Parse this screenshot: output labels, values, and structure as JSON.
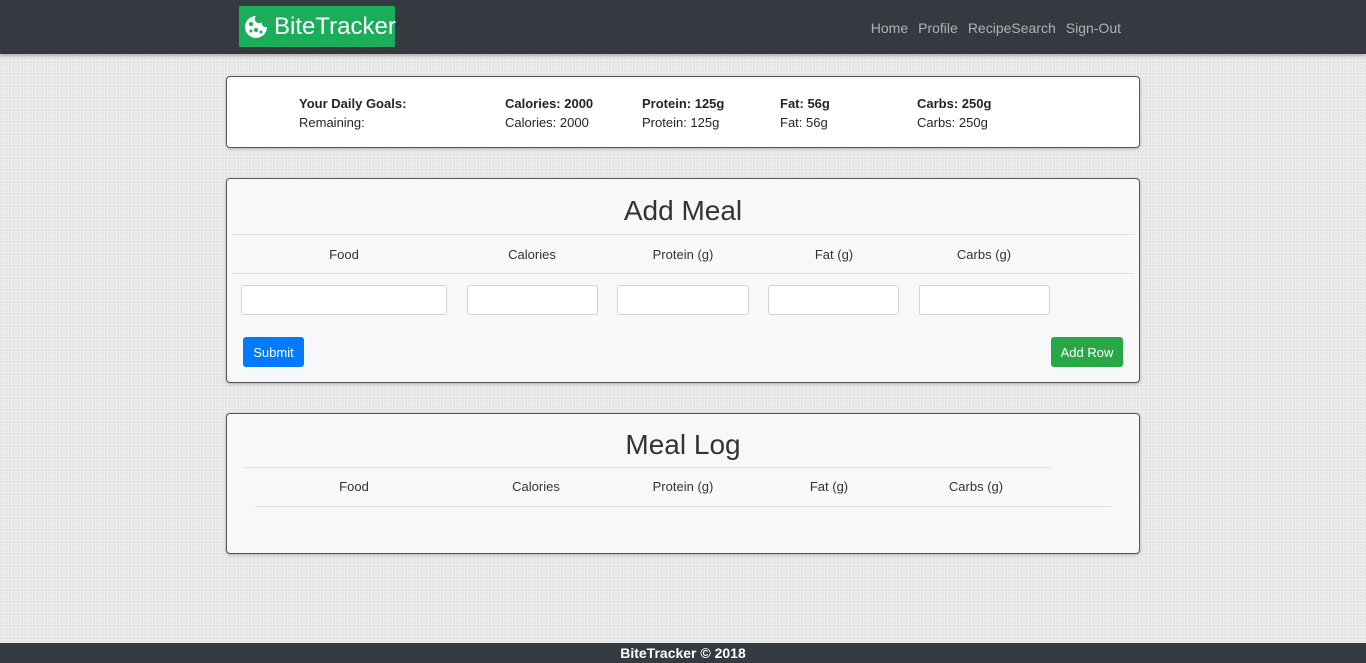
{
  "navbar": {
    "brand": "BiteTracker",
    "brand_icon": "cookie-icon",
    "links": [
      "Home",
      "Profile",
      "RecipeSearch",
      "Sign-Out"
    ]
  },
  "goals": {
    "labels": {
      "goals": "Your Daily Goals:",
      "remaining": "Remaining:"
    },
    "daily": {
      "calories": "Calories: 2000",
      "protein": "Protein: 125g",
      "fat": "Fat: 56g",
      "carbs": "Carbs: 250g"
    },
    "remaining": {
      "calories": "Calories: 2000",
      "protein": "Protein: 125g",
      "fat": "Fat: 56g",
      "carbs": "Carbs: 250g"
    }
  },
  "add_meal": {
    "title": "Add Meal",
    "columns": [
      "Food",
      "Calories",
      "Protein (g)",
      "Fat (g)",
      "Carbs (g)"
    ],
    "inputs": {
      "food": "",
      "calories": "",
      "protein": "",
      "fat": "",
      "carbs": ""
    },
    "submit_label": "Submit",
    "add_row_label": "Add Row"
  },
  "meal_log": {
    "title": "Meal Log",
    "columns": [
      "Food",
      "Calories",
      "Protein (g)",
      "Fat (g)",
      "Carbs (g)"
    ]
  },
  "footer": {
    "text": "BiteTracker © 2018"
  },
  "colors": {
    "navbar": "#343a40",
    "brand": "#1aae5a",
    "submit": "#007bff",
    "add_row": "#28a745"
  }
}
